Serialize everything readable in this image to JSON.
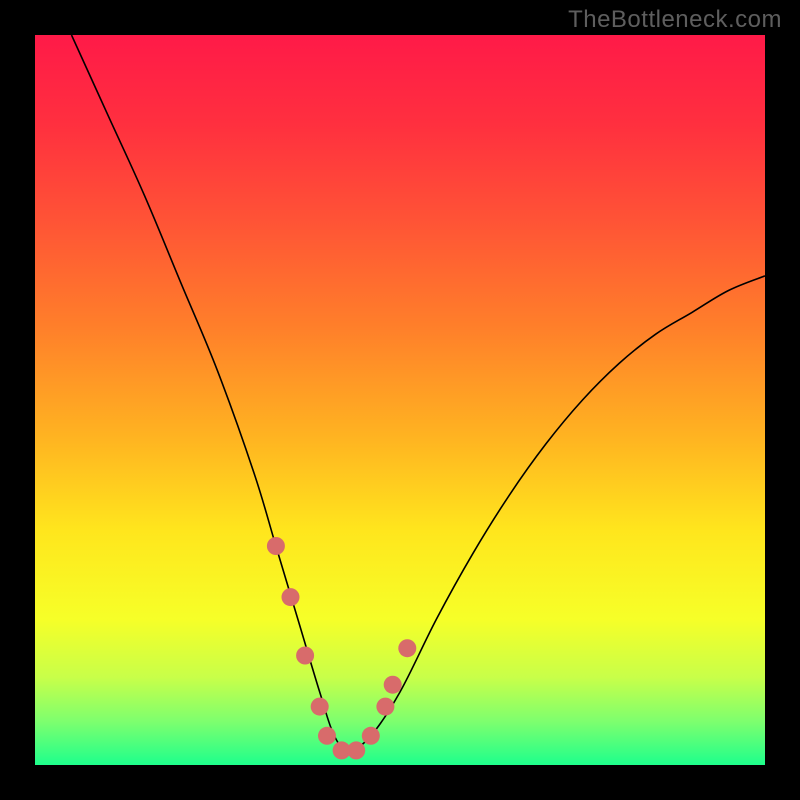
{
  "watermark": "TheBottleneck.com",
  "chart_data": {
    "type": "line",
    "title": "",
    "xlabel": "",
    "ylabel": "",
    "xlim": [
      0,
      100
    ],
    "ylim": [
      0,
      100
    ],
    "grid": false,
    "legend": false,
    "series": [
      {
        "name": "bottleneck-curve",
        "x": [
          5,
          10,
          15,
          20,
          25,
          30,
          33,
          36,
          39,
          41,
          43,
          46,
          50,
          55,
          60,
          65,
          70,
          75,
          80,
          85,
          90,
          95,
          100
        ],
        "y": [
          100,
          89,
          78,
          66,
          54,
          40,
          30,
          20,
          10,
          4,
          2,
          4,
          10,
          20,
          29,
          37,
          44,
          50,
          55,
          59,
          62,
          65,
          67
        ],
        "color": "#000000"
      }
    ],
    "highlight_points": {
      "name": "bottleneck-region",
      "color": "#d86b6b",
      "points": [
        {
          "x": 33,
          "y": 30
        },
        {
          "x": 35,
          "y": 23
        },
        {
          "x": 37,
          "y": 15
        },
        {
          "x": 39,
          "y": 8
        },
        {
          "x": 40,
          "y": 4
        },
        {
          "x": 42,
          "y": 2
        },
        {
          "x": 44,
          "y": 2
        },
        {
          "x": 46,
          "y": 4
        },
        {
          "x": 48,
          "y": 8
        },
        {
          "x": 49,
          "y": 11
        },
        {
          "x": 51,
          "y": 16
        }
      ]
    },
    "background_gradient": {
      "stops": [
        {
          "offset": 0.0,
          "color": "#ff1a48"
        },
        {
          "offset": 0.12,
          "color": "#ff2f3f"
        },
        {
          "offset": 0.25,
          "color": "#ff5236"
        },
        {
          "offset": 0.4,
          "color": "#ff7f2a"
        },
        {
          "offset": 0.55,
          "color": "#ffb321"
        },
        {
          "offset": 0.68,
          "color": "#ffe61d"
        },
        {
          "offset": 0.8,
          "color": "#f6ff28"
        },
        {
          "offset": 0.88,
          "color": "#c8ff49"
        },
        {
          "offset": 0.94,
          "color": "#7eff6e"
        },
        {
          "offset": 1.0,
          "color": "#1eff8c"
        }
      ]
    }
  }
}
